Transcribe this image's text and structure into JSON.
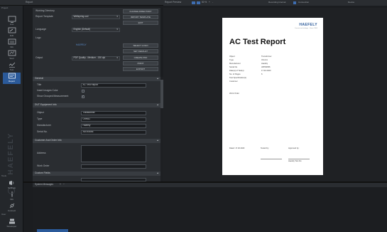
{
  "window": {
    "title": "Report",
    "preview_title": "Report Preview",
    "preview_tools": [
      "Fit",
      "Fit w",
      "50 %",
      "+",
      "-"
    ],
    "right_tools": [
      "Recording Interval",
      "Connection",
      "Device"
    ]
  },
  "sidebar": {
    "top_label": "Project",
    "items": [
      {
        "label": "Live",
        "icon": "monitor-icon"
      },
      {
        "label": "Edit",
        "icon": "edit-monitor-icon"
      },
      {
        "label": "Info",
        "icon": "info-monitor-icon"
      },
      {
        "label": "Start",
        "icon": "start-icon"
      },
      {
        "label": "Test",
        "icon": "test-icon"
      },
      {
        "label": "Report",
        "icon": "report-icon"
      }
    ],
    "brand": "HAEFELY",
    "tools_label": "Tools",
    "bottom_items": [
      {
        "label": "Settings",
        "icon": "settings-icon"
      },
      {
        "label": "Info",
        "icon": "info-icon"
      },
      {
        "label": "Connect",
        "icon": "connect-icon"
      }
    ],
    "user_label": "User",
    "user_item": {
      "label": "Developer",
      "icon": "user-icon"
    }
  },
  "report_settings": {
    "working_directory_label": "Working Directory",
    "report_template_label": "Report Template",
    "report_template_value": "Wellspring.ucd",
    "language_label": "Language",
    "language_value": "English (Default)",
    "logo_label": "Logo",
    "logo_text": "HAEFELY",
    "output_label": "Output",
    "output_value": "PDF Quality - Medium - 150 dpi",
    "buttons": {
      "change_directory": "CHANGE DIRECTORY",
      "import_template": "IMPORT TEMPLATE",
      "edit": "EDIT",
      "select_logo": "SELECT LOGO",
      "set_default": "SET DEFAULT",
      "create_pdf": "CREATE PDF",
      "print": "PRINT",
      "export": "EXPORT"
    }
  },
  "general": {
    "header": "General",
    "title_label": "Title",
    "title_value": "AC Test Report",
    "insert_images_label": "Insert Images Color",
    "show_grouped_label": "Show Grouped Measurement",
    "show_grouped_checked": "✓"
  },
  "dut": {
    "header": "DUT Equipment Info",
    "fields": [
      {
        "label": "Object",
        "value": "Transformer"
      },
      {
        "label": "Type",
        "value": "Ohm41"
      },
      {
        "label": "Manufacturer",
        "value": "Haefely"
      },
      {
        "label": "Serial No.",
        "value": "AB784656"
      }
    ]
  },
  "customer": {
    "header": "Customer And Order Info",
    "address_label": "Address",
    "work_order_label": "Work Order"
  },
  "custom_fields": {
    "header": "Custom Fields"
  },
  "status": {
    "system_messages": "System Messages"
  },
  "paper": {
    "logo": "HAEFELY",
    "logo_sub": "Current and voltage · Since 1904",
    "title": "AC Test Report",
    "rows": [
      {
        "k": "Object",
        "v": "Transformer"
      },
      {
        "k": "Type",
        "v": "Ohm41"
      },
      {
        "k": "Manufacturer",
        "v": "Haefely"
      },
      {
        "k": "Serial No.",
        "v": "AB784656"
      },
      {
        "k": "Date(s) of Test(s)",
        "v": "17.02.2023"
      },
      {
        "k": "No. of Pages",
        "v": "6"
      },
      {
        "k": "Test Specification(s)",
        "v": ""
      },
      {
        "k": "Customer",
        "v": ""
      }
    ],
    "work_order": "Work Order",
    "sign_date": "Dated: 17.02.2023",
    "sign_tested": "Tested by:",
    "sign_approved": "Approved by:",
    "sign_name": "Haefely Test AG"
  }
}
